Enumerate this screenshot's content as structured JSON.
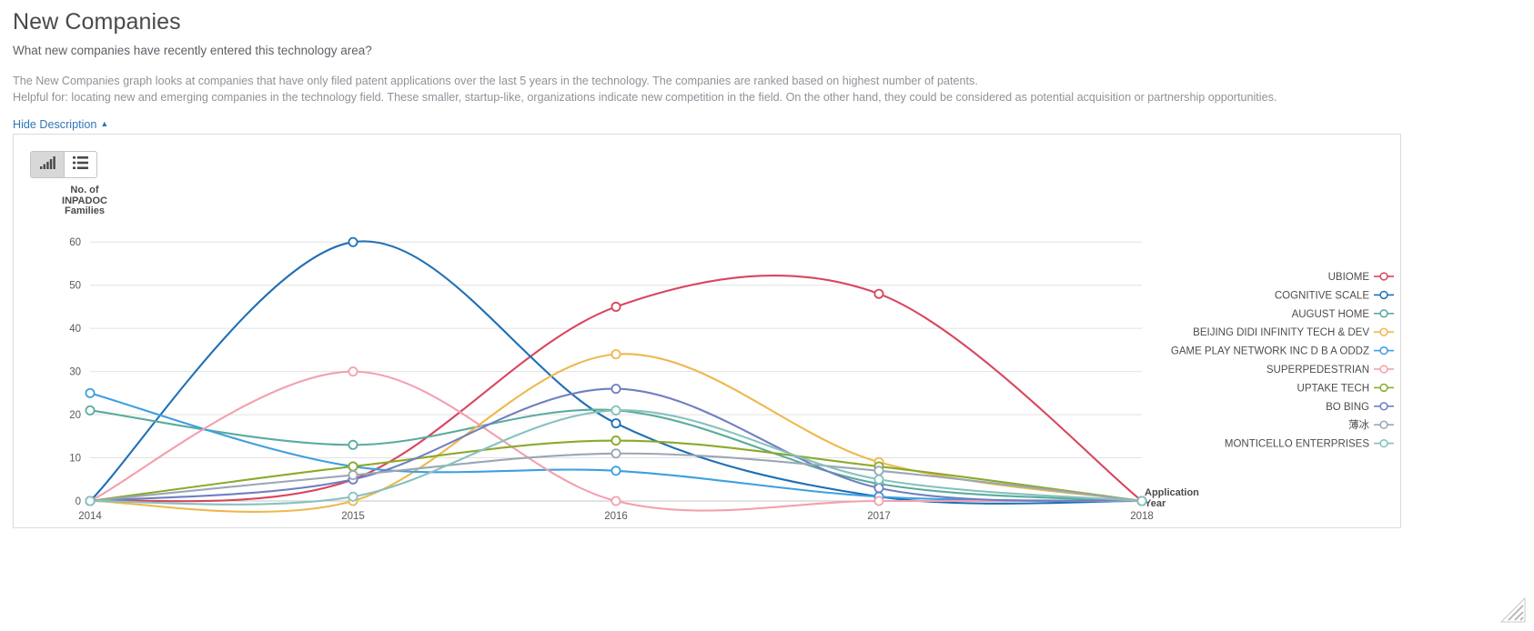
{
  "header": {
    "title": "New Companies",
    "subtitle": "What new companies have recently entered this technology area?",
    "description_line1": "The New Companies graph looks at companies that have only filed patent applications over the last 5 years in the technology. The companies are ranked based on highest number of patents.",
    "description_line2": "Helpful for: locating new and emerging companies in the technology field. These smaller, startup-like, organizations indicate new competition in the field. On the other hand, they could be considered as potential acquisition or partnership opportunities.",
    "hide_description_label": "Hide Description",
    "hide_description_caret": "▲"
  },
  "toolbar": {
    "chart_view_label": "chart-view",
    "chart_view_icon": "bar-chart-icon",
    "list_view_label": "list-view",
    "list_view_icon": "list-icon",
    "active_view": "chart"
  },
  "chart_data": {
    "type": "line",
    "title": "",
    "xlabel": "Application Year",
    "ylabel": "No. of INPADOC Families",
    "categories": [
      "2014",
      "2015",
      "2016",
      "2017",
      "2018"
    ],
    "yticks": [
      0,
      10,
      20,
      30,
      40,
      50,
      60
    ],
    "ylim": [
      0,
      63
    ],
    "grid": true,
    "legend_position": "right",
    "series": [
      {
        "name": "UBIOME",
        "color": "#d9455f",
        "values": [
          0,
          5,
          45,
          48,
          0
        ]
      },
      {
        "name": "COGNITIVE SCALE",
        "color": "#1f6fb4",
        "values": [
          0,
          60,
          18,
          1,
          0
        ]
      },
      {
        "name": "AUGUST HOME",
        "color": "#5aab9e",
        "values": [
          21,
          13,
          21,
          4,
          0
        ]
      },
      {
        "name": "BEIJING DIDI INFINITY TECH & DEV",
        "color": "#edb84e",
        "values": [
          0,
          0,
          34,
          9,
          0
        ]
      },
      {
        "name": "GAME PLAY NETWORK INC D B A ODDZ",
        "color": "#3d9fe0",
        "values": [
          25,
          8,
          7,
          1,
          0
        ]
      },
      {
        "name": "SUPERPEDESTRIAN",
        "color": "#f2a0ae",
        "values": [
          0,
          30,
          0,
          0,
          0
        ]
      },
      {
        "name": "UPTAKE TECH",
        "color": "#8aaa2b",
        "values": [
          0,
          8,
          14,
          8,
          0
        ]
      },
      {
        "name": "BO BING",
        "color": "#6f7fc0",
        "values": [
          0,
          5,
          26,
          3,
          0
        ]
      },
      {
        "name": "薄冰",
        "color": "#9aa7b5",
        "values": [
          0,
          6,
          11,
          7,
          0
        ]
      },
      {
        "name": "MONTICELLO ENTERPRISES",
        "color": "#86c2bd",
        "values": [
          0,
          1,
          21,
          5,
          0
        ]
      }
    ]
  }
}
